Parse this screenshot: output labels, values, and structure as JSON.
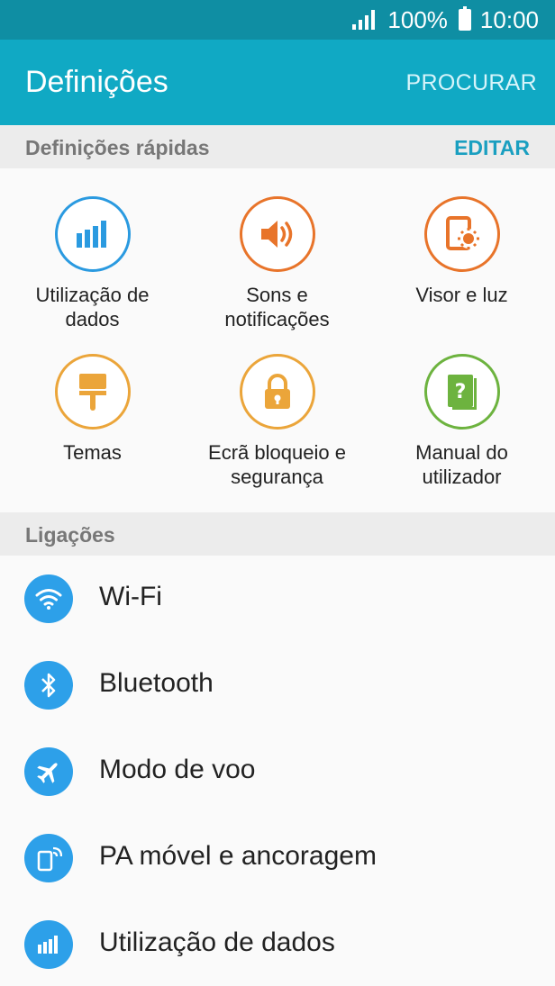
{
  "status": {
    "battery": "100%",
    "time": "10:00"
  },
  "header": {
    "title": "Definições",
    "search_label": "PROCURAR"
  },
  "quick_settings": {
    "label": "Definições rápidas",
    "edit_label": "EDITAR",
    "items": [
      {
        "line1": "Utilização de",
        "line2": "dados",
        "color": "#2a9ae0"
      },
      {
        "line1": "Sons e",
        "line2": "notificações",
        "color": "#e8742a"
      },
      {
        "line1": "Visor e luz",
        "line2": "",
        "color": "#e8742a"
      },
      {
        "line1": "Temas",
        "line2": "",
        "color": "#eba53a"
      },
      {
        "line1": "Ecrã bloqueio e",
        "line2": "segurança",
        "color": "#eba53a"
      },
      {
        "line1": "Manual do",
        "line2": "utilizador",
        "color": "#6db33f"
      }
    ]
  },
  "connections": {
    "label": "Ligações",
    "items": [
      {
        "label": "Wi-Fi"
      },
      {
        "label": "Bluetooth"
      },
      {
        "label": "Modo de voo"
      },
      {
        "label": "PA móvel e ancoragem"
      },
      {
        "label": "Utilização de dados"
      }
    ]
  },
  "colors": {
    "status_bar": "#0f8ea3",
    "app_bar": "#10a9c4",
    "accent": "#1a9fc0",
    "list_icon": "#2da0e9"
  },
  "icons": [
    "signal-icon",
    "battery-icon",
    "data-usage-icon",
    "sound-icon",
    "display-icon",
    "themes-icon",
    "lock-icon",
    "manual-icon",
    "wifi-icon",
    "bluetooth-icon",
    "airplane-icon",
    "hotspot-icon"
  ]
}
